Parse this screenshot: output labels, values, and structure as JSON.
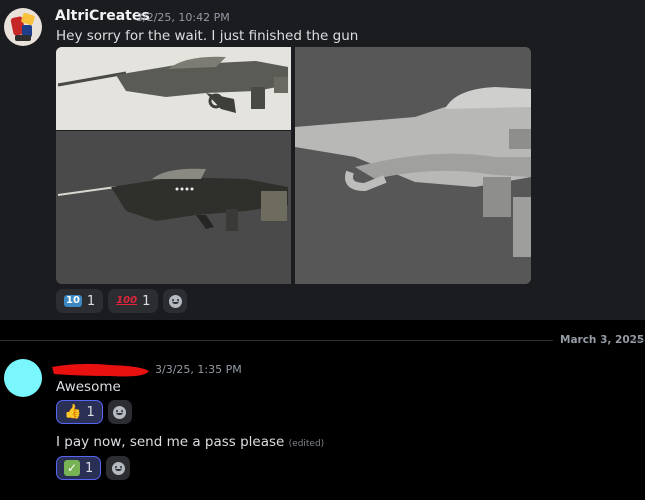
{
  "message1": {
    "author": "AltriCreates",
    "timestamp": "3/2/25, 10:42 PM",
    "text": "Hey sorry for the wait. I just finished the gun",
    "attachments": [
      "gun-render-side-light",
      "gun-render-side-dark",
      "gun-render-closeup"
    ],
    "reactions": [
      {
        "emoji": "keycap-ten",
        "glyph": "10",
        "count": "1"
      },
      {
        "emoji": "hundred-points",
        "glyph": "100",
        "count": "1"
      }
    ]
  },
  "divider": {
    "date": "March 3, 2025"
  },
  "message2": {
    "timestamp": "3/3/25, 1:35 PM",
    "avatar_color": "#79f7fc",
    "lines": [
      {
        "text": "Awesome",
        "edited": "",
        "reaction": {
          "emoji": "thumbs-up",
          "glyph": "👍",
          "count": "1"
        }
      },
      {
        "text": "I pay now, send me a pass please",
        "edited": "(edited)",
        "reaction": {
          "emoji": "check-mark-button",
          "glyph": "✓",
          "count": "1"
        }
      }
    ]
  },
  "colors": {
    "background": "#000000",
    "message_bg": "#1b1c1f",
    "active_reaction_border": "#5865f2",
    "redaction": "#e8110f"
  }
}
